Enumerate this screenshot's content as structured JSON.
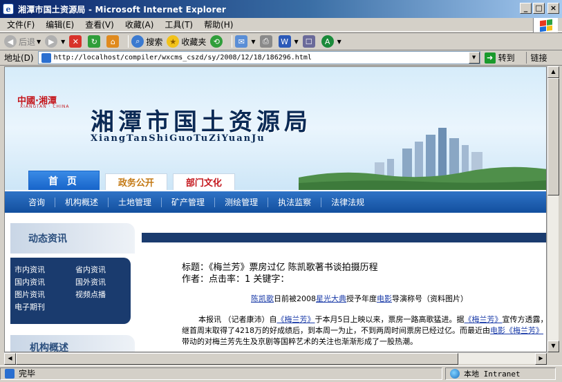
{
  "window": {
    "title": "湘潭市国土资源局 - Microsoft Internet Explorer",
    "min": "_",
    "max": "□",
    "close": "×"
  },
  "menu": [
    "文件(F)",
    "编辑(E)",
    "查看(V)",
    "收藏(A)",
    "工具(T)",
    "帮助(H)"
  ],
  "toolbar": {
    "back": "后退",
    "search": "搜索",
    "favorites": "收藏夹"
  },
  "address": {
    "label": "地址(D)",
    "url": "http://localhost/compiler/wxcms_cszd/sy/2008/12/18/186296.html",
    "go": "转到",
    "links": "链接"
  },
  "banner": {
    "logo": "中國·湘潭",
    "logo_sub": "XIANGTAN · CHINA",
    "title": "湘潭市国土资源局",
    "pinyin": "XiangTanShiGuoTuZiYuanJu",
    "tabs": [
      "首 页",
      "政务公开",
      "部门文化"
    ]
  },
  "nav": [
    "咨询",
    "机构概述",
    "土地管理",
    "矿产管理",
    "测绘管理",
    "执法监察",
    "法律法规"
  ],
  "sidebar": {
    "heading1": "动态资讯",
    "links": [
      "市内资讯",
      "省内资讯",
      "国内资讯",
      "国外资讯",
      "图片资讯",
      "视频点播",
      "电子期刊"
    ],
    "heading2": "机构概述"
  },
  "article": {
    "title": "标题：《梅兰芳》票房过亿 陈凯歌著书谈拍摄历程",
    "meta": "作者：点击率：1 关键字：",
    "caption_link1": "陈凯歌",
    "caption_t1": "日前被2008",
    "caption_link2": "星光大典",
    "caption_t2": "授予年度",
    "caption_link3": "电影",
    "caption_t3": "导演称号（资料图片）",
    "body_t1": "本报讯 （记者康沛）自",
    "body_link1": "《梅兰芳》",
    "body_t2": "于本月5日上映以来，票房一路高歌猛进。据",
    "body_link2": "《梅兰芳》",
    "body_t3": "宣传方透露，继首周末取得了4218万的好成绩后，到本周一为止，不到两周时间票房已经过亿。而最近由",
    "body_link3": "电影《梅兰芳》",
    "body_t4": "带动的对梅兰芳先生及京剧等国粹艺术的关注也渐渐形成了一股热潮。"
  },
  "status": {
    "text": "完毕",
    "zone": "本地 Intranet"
  },
  "icons": {
    "app": "ie-icon",
    "go": "go-arrow-icon",
    "zone": "globe-icon"
  }
}
